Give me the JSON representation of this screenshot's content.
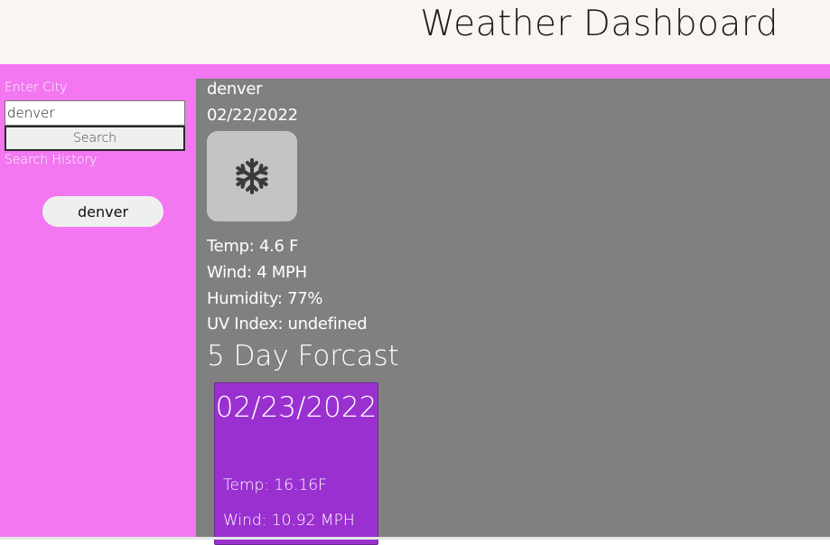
{
  "header": {
    "title": "Weather Dashboard"
  },
  "sidebar": {
    "enter_city_label": "Enter City",
    "search_input_value": "denver",
    "search_button_label": "Search",
    "history_label": "Search History:",
    "history": [
      "denver"
    ]
  },
  "current": {
    "city": "denver",
    "date": "02/22/2022",
    "icon": "snowflake-icon",
    "temp": "Temp: 4.6 F",
    "wind": "Wind: 4 MPH",
    "humidity": "Humidity: 77%",
    "uv": "UV Index: undefined"
  },
  "forecast": {
    "title": "5 Day Forcast",
    "days": [
      {
        "date": "02/23/2022",
        "temp": "Temp: 16.16F",
        "wind": "Wind: 10.92 MPH"
      }
    ]
  },
  "colors": {
    "header_bg": "#faf5f1",
    "sidebar_bg": "#f277f0",
    "main_bg": "#808080",
    "card_bg": "#9b30d0"
  }
}
